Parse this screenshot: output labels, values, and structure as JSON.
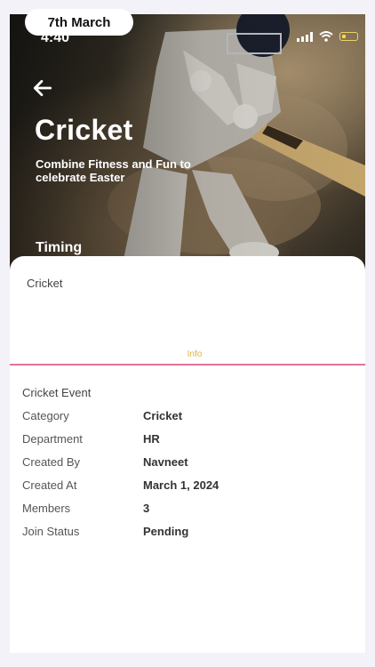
{
  "status_bar": {
    "time": "4:40"
  },
  "date_badge": "7th March",
  "hero": {
    "title": "Cricket",
    "subtitle": "Combine Fitness and Fun to celebrate Easter",
    "timing_label": "Timing"
  },
  "sheet": {
    "title": "Cricket",
    "tab_label": "Info",
    "section_label": "Cricket Event",
    "details": [
      {
        "key": "Category",
        "value": "Cricket"
      },
      {
        "key": "Department",
        "value": "HR"
      },
      {
        "key": "Created By",
        "value": "Navneet"
      },
      {
        "key": "Created At",
        "value": "March 1, 2024"
      },
      {
        "key": "Members",
        "value": "3"
      },
      {
        "key": "Join Status",
        "value": "Pending"
      }
    ]
  },
  "colors": {
    "tab_accent": "#e0739c",
    "tab_text": "#d7b24c",
    "page_bg": "#f3f2f8"
  }
}
